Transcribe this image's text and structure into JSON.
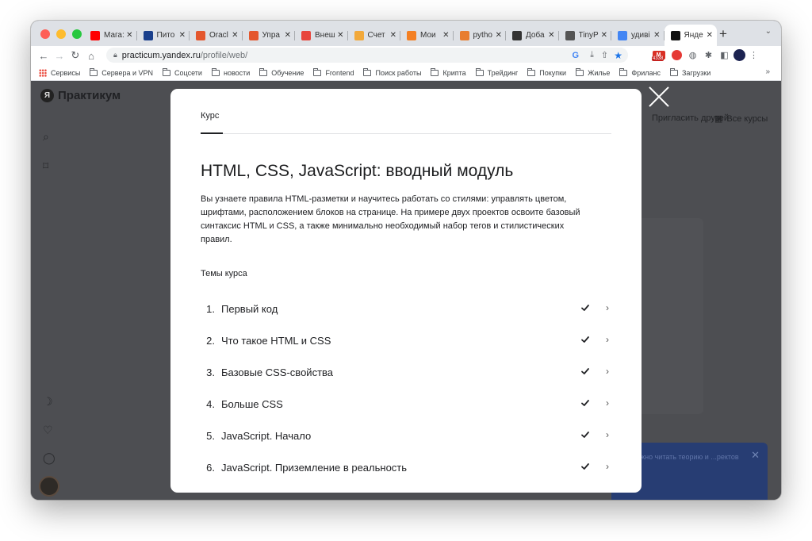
{
  "browser": {
    "tabs": [
      {
        "title": "Мага:",
        "favicon": "youtube-icon",
        "color": "#ff0000"
      },
      {
        "title": "Пито",
        "favicon": "pythontutor-icon",
        "color": "#1a3f8c"
      },
      {
        "title": "Oracl",
        "favicon": "terminal-icon",
        "color": "#e4572e"
      },
      {
        "title": "Упра",
        "favicon": "target-icon",
        "color": "#e4572e"
      },
      {
        "title": "Внеш",
        "favicon": "search-icon",
        "color": "#e8453c"
      },
      {
        "title": "Счет",
        "favicon": "circle-icon",
        "color": "#f2a93b"
      },
      {
        "title": "Мои",
        "favicon": "stackoverflow-icon",
        "color": "#f48024"
      },
      {
        "title": "pytho",
        "favicon": "python-icon",
        "color": "#e87d2f"
      },
      {
        "title": "Доба",
        "favicon": "image-icon",
        "color": "#333333"
      },
      {
        "title": "TinyP",
        "favicon": "panda-icon",
        "color": "#555555"
      },
      {
        "title": "удиві",
        "favicon": "google-icon",
        "color": "#4285f4"
      },
      {
        "title": "Янде",
        "favicon": "practicum-icon",
        "color": "#111111"
      }
    ],
    "new_tab": "+",
    "url_host": "practicum.yandex.ru",
    "url_path": "/profile/web/",
    "gmail_badge": "4338",
    "bookmarks": [
      "Сервисы",
      "Сервера и VPN",
      "Соцсети",
      "новости",
      "Обучение",
      "Frontend",
      "Поиск работы",
      "Крипта",
      "Трейдинг",
      "Покупки",
      "Жилье",
      "Фриланс",
      "Загрузки"
    ],
    "bookmarks_more": "»"
  },
  "site": {
    "logo_letter": "Я",
    "logo": "Практикум",
    "header_links": [
      "Пригласить друзей",
      "Все курсы"
    ],
    "toast_text": "...и можно читать теорию и ...ректов"
  },
  "modal": {
    "tab": "Курс",
    "title": "HTML, CSS, JavaScript: вводный модуль",
    "description": "Вы узнаете правила HTML-разметки и научитесь работать со стилями: управлять цветом, шрифтами, расположением блоков на странице. На примере двух проектов освоите базовый синтаксис HTML и CSS, а также минимально необходимый набор тегов и стилистических правил.",
    "topics_heading": "Темы курса",
    "topics": [
      {
        "num": "1.",
        "title": "Первый код",
        "done": true
      },
      {
        "num": "2.",
        "title": "Что такое HTML и CSS",
        "done": true
      },
      {
        "num": "3.",
        "title": "Базовые CSS-свойства",
        "done": true
      },
      {
        "num": "4.",
        "title": "Больше CSS",
        "done": true
      },
      {
        "num": "5.",
        "title": "JavaScript. Начало",
        "done": true
      },
      {
        "num": "6.",
        "title": "JavaScript. Приземление в реальность",
        "done": true
      }
    ]
  }
}
